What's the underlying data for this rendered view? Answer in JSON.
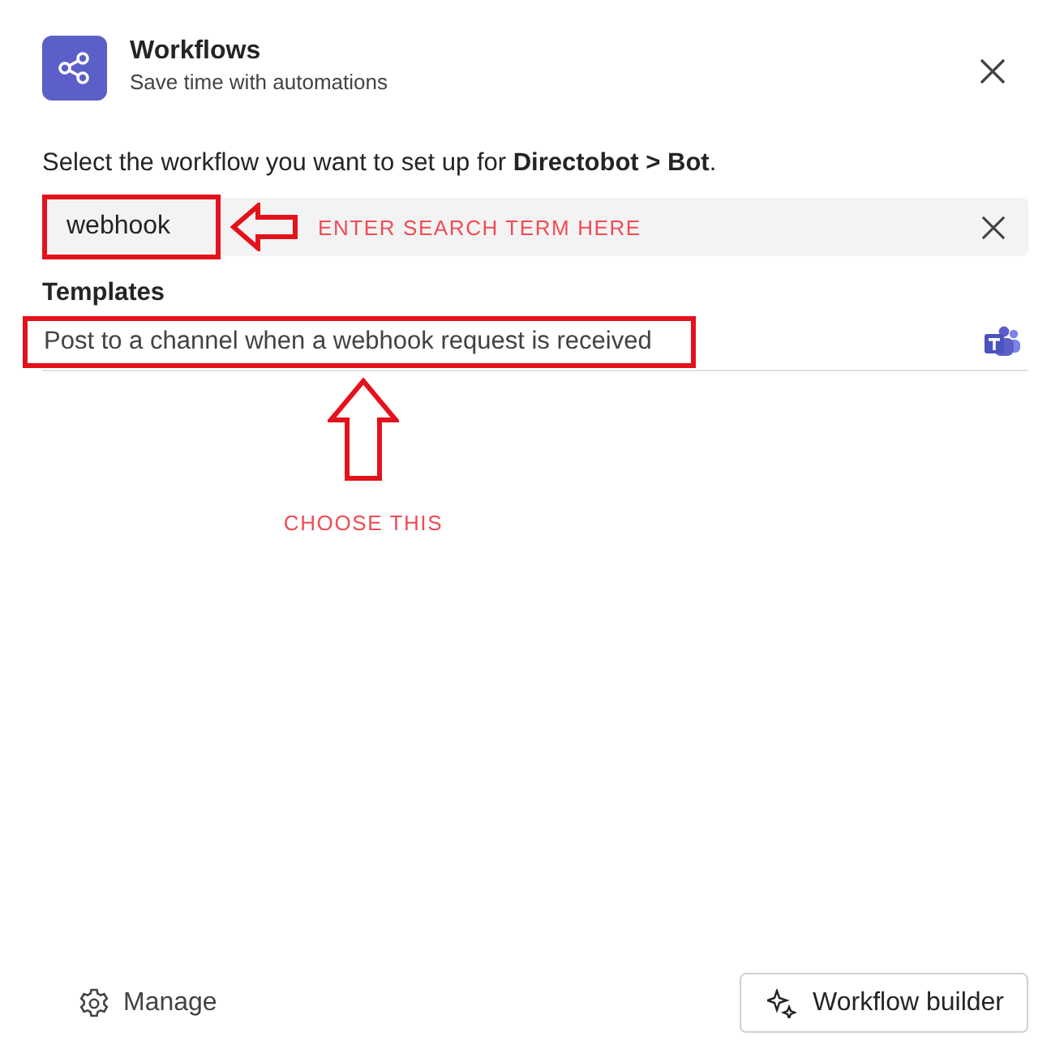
{
  "dialog": {
    "title": "Workflows",
    "subtitle": "Save time with automations",
    "instruction": "Select the workflow you want to set up for **Directobot > Bot**."
  },
  "search": {
    "value": "webhook"
  },
  "templates": {
    "heading": "Templates",
    "items": [
      {
        "label": "Post to a channel when a webhook request is received",
        "highlighted": true
      }
    ]
  },
  "annotations": [
    {
      "kind": "left-arrow",
      "text": "ENTER SEARCH TERM HERE"
    },
    {
      "kind": "up-arrow",
      "text": "CHOOSE THIS"
    }
  ],
  "footer": {
    "manage": "Manage",
    "builder": "Workflow builder"
  }
}
